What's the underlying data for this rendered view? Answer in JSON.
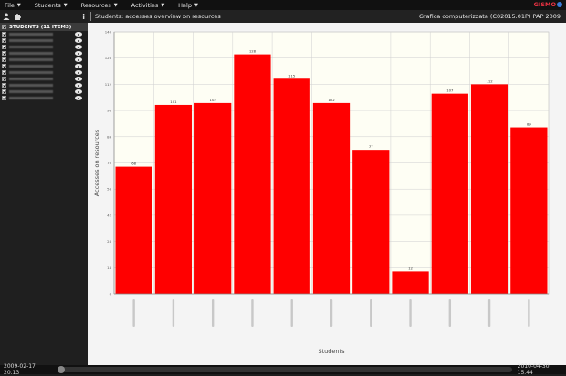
{
  "menu": [
    {
      "label": "File"
    },
    {
      "label": "Students"
    },
    {
      "label": "Resources"
    },
    {
      "label": "Activities"
    },
    {
      "label": "Help"
    }
  ],
  "logo": "GISMO",
  "sidebar": {
    "header": "STUDENTS (11 ITEMS)",
    "info_icon": "i"
  },
  "title": "Students: accesses overview on resources",
  "course": "Grafica computerizzata (C02015.01P) PAP 2009",
  "chart_data": {
    "type": "bar",
    "categories": [
      "",
      "",
      "",
      "",
      "",
      "",
      "",
      "",
      "",
      "",
      ""
    ],
    "values": [
      68,
      101,
      102,
      128,
      115,
      102,
      77,
      12,
      107,
      112,
      89
    ],
    "ylabel": "Accesses on resources",
    "xlabel": "Students",
    "ylim": [
      0,
      140
    ],
    "yticks": [
      0,
      14,
      28,
      42,
      56,
      70,
      84,
      98,
      112,
      126,
      140
    ],
    "bar_color": "#ff0000",
    "grid": true
  },
  "status": {
    "start": "2009-02-17 20.13",
    "end": "2010-04-30 15.44",
    "slider_position": 0
  },
  "colors": {
    "bar": "#ff0000",
    "background": "#1e1e1e",
    "plot": "#fefef4"
  }
}
